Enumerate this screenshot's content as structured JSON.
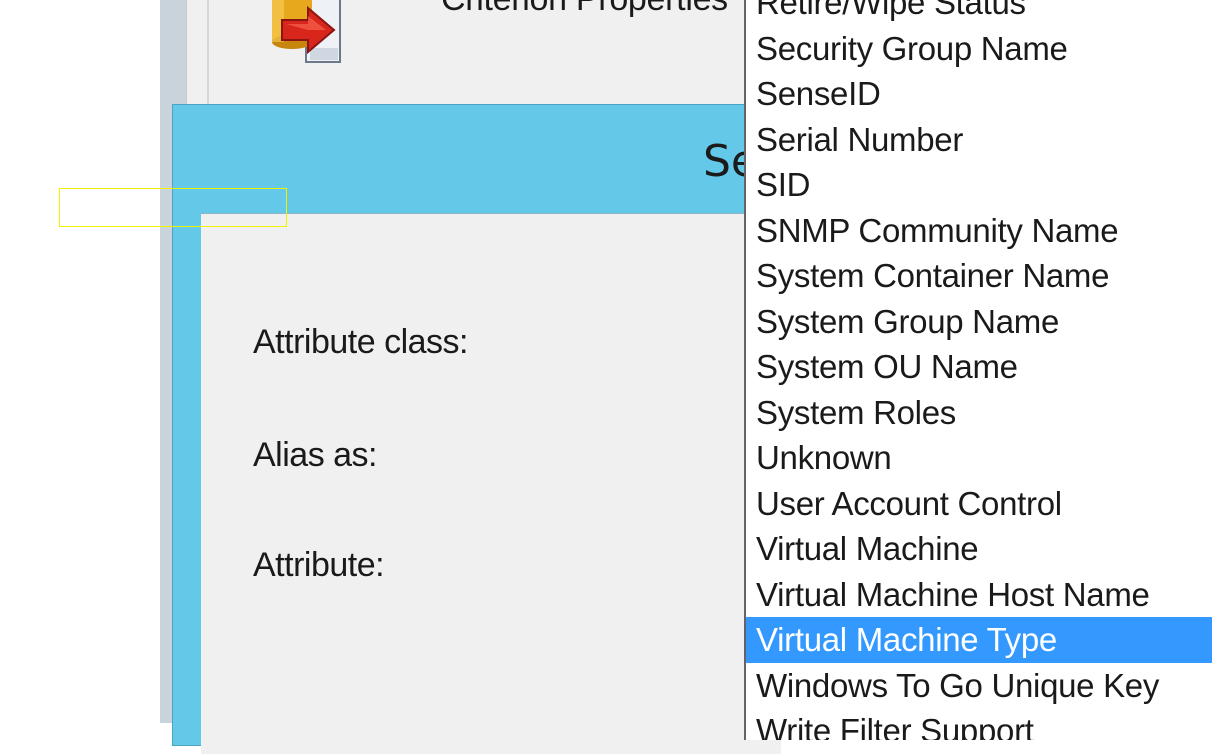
{
  "background_window": {
    "criterion_label": "Criterion Properties"
  },
  "dialog": {
    "title_fragment": "Se",
    "fields": {
      "attribute_class_label": "Attribute class:",
      "alias_as_label": "Alias as:",
      "attribute_label": "Attribute:"
    }
  },
  "dropdown": {
    "selected": "Virtual Machine Type",
    "items": [
      "Retire/Wipe Status",
      "Security Group Name",
      "SenseID",
      "Serial Number",
      "SID",
      "SNMP Community Name",
      "System Container Name",
      "System Group Name",
      "System OU Name",
      "System Roles",
      "Unknown",
      "User Account Control",
      "Virtual Machine",
      "Virtual Machine Host Name",
      "Virtual Machine Type",
      "Windows To Go Unique Key",
      "Write Filter Support"
    ]
  },
  "colors": {
    "dialog_title_bar": "#64c8e8",
    "selection": "#3399ff",
    "focus_rect": "#f2f200",
    "panel": "#f0f0f0"
  },
  "icons": {
    "criterion": "criterion-properties-icon"
  }
}
